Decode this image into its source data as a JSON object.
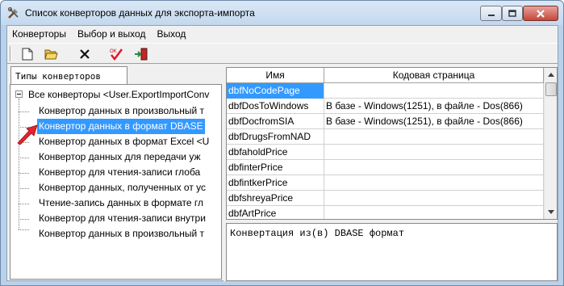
{
  "window": {
    "title": "Список конверторов данных для экспорта-импорта",
    "app_icon": "tools-icon",
    "controls": [
      "minimize",
      "maximize",
      "close"
    ]
  },
  "menu": {
    "items": [
      "Конверторы",
      "Выбор и выход",
      "Выход"
    ]
  },
  "toolbar": {
    "buttons": [
      {
        "name": "new-document-icon"
      },
      {
        "name": "open-folder-icon"
      },
      {
        "name": "delete-icon"
      },
      {
        "name": "check-ok-icon"
      },
      {
        "name": "exit-door-icon"
      }
    ]
  },
  "left": {
    "tab_label": "Типы конверторов",
    "tree": {
      "root": "Все конверторы <User.ExportImportConv",
      "children": [
        "Конвертор данных в произвольный т",
        "Конвертор данных в формат DBASE",
        "Конвертор данных в формат Excel <U",
        "Конвертор данных для передачи уж",
        "Конвертор для чтения-записи глоба",
        "Конвертор данных, полученных от ус",
        "Чтение-запись данных в формате гл",
        "Конвертор для чтения-записи внутри",
        "Конвертор данных в произвольный т"
      ],
      "selected_index": 1
    }
  },
  "grid": {
    "columns": [
      "Имя",
      "Кодовая страница"
    ],
    "rows": [
      [
        "dbfNoCodePage",
        ""
      ],
      [
        "dbfDosToWindows",
        "В базе - Windows(1251), в файле - Dos(866)"
      ],
      [
        "dbfDocfromSIA",
        "В базе - Windows(1251), в файле - Dos(866)"
      ],
      [
        "dbfDrugsFromNAD",
        ""
      ],
      [
        "dbfaholdPrice",
        ""
      ],
      [
        "dbfinterPrice",
        ""
      ],
      [
        "dbfintkerPrice",
        ""
      ],
      [
        "dbfshreyaPrice",
        ""
      ],
      [
        "dbfArtPrice",
        ""
      ]
    ],
    "selected_row": 0
  },
  "description": "Конвертация из(в) DBASE формат",
  "colors": {
    "selection": "#3399ff",
    "titlebar": "#c3d8ee",
    "arrow": "#e8232f"
  }
}
